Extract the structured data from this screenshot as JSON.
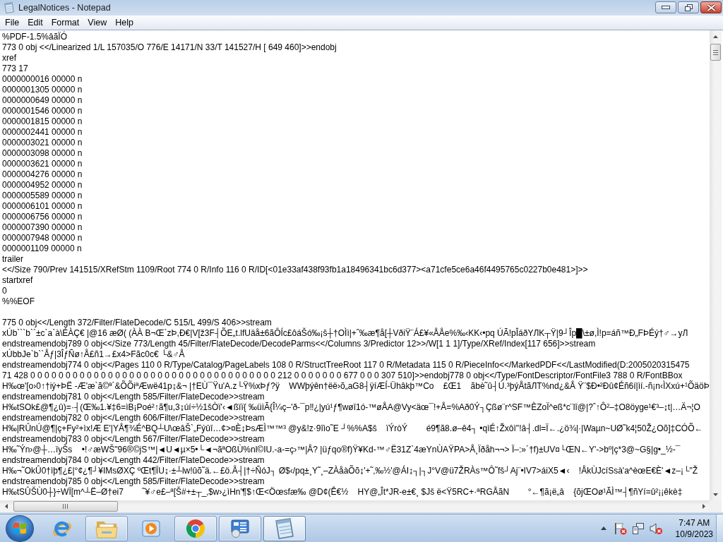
{
  "window": {
    "title": "LegalNotices - Notepad"
  },
  "menu_bar": [
    "File",
    "Edit",
    "Format",
    "View",
    "Help"
  ],
  "editor": {
    "sections": [
      {
        "lines": [
          "%PDF-1.5%âãÏÓ",
          "773 0 obj <</Linearized 1/L 157035/O 776/E 14171/N 33/T 141527/H [ 649 460]>>endobj",
          "xref",
          "773 17",
          "0000000016 00000 n",
          "0000001305 00000 n",
          "0000000649 00000 n",
          "0000001546 00000 n",
          "0000001815 00000 n",
          "0000002441 00000 n",
          "0000003021 00000 n",
          "0000003098 00000 n",
          "0000003621 00000 n",
          "0000004276 00000 n",
          "0000004952 00000 n",
          "0000005589 00000 n",
          "0000006101 00000 n",
          "0000006756 00000 n",
          "0000007390 00000 n",
          "0000007948 00000 n",
          "0000001109 00000 n",
          "trailer",
          "<</Size 790/Prev 141515/XRefStm 1109/Root 774 0 R/Info 116 0 R/ID[<01e33af438f93fb1a18496341bc6d377><a71cfe5ce6a46f4495765c0227b0e481>]>>",
          "startxref",
          "0",
          "%%EOF"
        ]
      },
      {
        "lines": [
          "775 0 obj<</Length 372/Filter/FlateDecode/C 515/L 499/S 406>>stream",
          "xÚb```b``±c`a`à\\ÉÀÇ€ |@16 æØ( (ÀÀ B¬Œ`zÞ,Ð€|V[ž3F┤ÕE„t.lfUäå±6ãÔÍc£ôáŠó‰¡š┼†OÌì|+ˆ‰æ¶å[┼VðiŸ¨Á£¥«ÅÅe%‰‹KK‹•pq ÚÃ!pÎáðYЛK┬Ÿ|9┘Îp█\\±ø,Ì!p=áñ™Ð„FÞÉý†♂→yЛ",
          "endstreamendobj789 0 obj<</Size 773/Length 45/Filter/FlateDecode/DecodeParms<</Columns 3/Predictor 12>>/W[1 1 1]/Type/XRef/Index[117 656]>>stream",
          "xÚbbJe`b``Åƒ|3ÎƒÑø↑Å£ñ1→£x4>Fãc0c€ └&♂Å",
          "endstreamendobj774 0 obj<</Pages 110 0 R/Type/Catalog/PageLabels 108 0 R/StructTreeRoot 117 0 R/Metadata 115 0 R/PieceInfo<</MarkedPDF<</LastModified(D:2005020315475",
          "71 428 0 0 0 0 0 0 0 0 0 0 0 0 0 0 0 0 0 0 0 0 0 0 0 0 0 0 0 0 0 0 0 0 0 0 0 212 0 0 0 0 0 0 0 677 0 0 0 307 510]>>endobj778 0 obj<</Type/FontDescriptor/FontFile3 788 0 R/FontBBox",
          "H‰œ'[o›0↑†iý+ÞË -Æ'æ`ã©ª´&ÕÕiªÆwë41p↨&¬ |†EÙ¯Ÿu'A.z└Ÿ%xÞƒ?ÿ    WWþýên†ëë›õ„aG8┤ÿíÆÍ-Ühâkþ™Co    £Œ1    ãbè˜û┤Ú.³þýÅtãЛT%nd¿&Å Ÿ¨$Ð•²Ðû¢Éñ6í|ìí.-ñ¡n‹ÌXxú+¹ÕäöÞ",
          "endstreamendobj781 0 obj<</Length 585/Filter/FlateDecode>>stream",
          "H‰tSOk£@¶¿û)=·┤(Œ‰1.¥‡6=ìB¡Poé²↑ã¶u,3↨úí÷½1šÒï'‹◄ßïï{ ‰üìÃ{Î¼ç–'ð-¯p‼¿|yú¹ƒ¶wøî1ó-™øÅA@Vy<äœ¯!+Å=%Að0Ý┐Çßø¨r^SF™ÈZoÏ^eß*c¨lî@|?ˆ↑Ô²–‡O8öyge¹€³–↨t|…Ä¬¦O",
          "endstreamendobj782 0 obj<</Length 606/Filter/FlateDecode>>stream",
          "H‰|RÛnÚ@¶|ç+Fy²+ìx!Æ E'|YÅ¶¾É^BQ┴U\\œâŠ`„Fýûî…¢>¤È↨ÞsÆÌ™™³ @y&!z·9îìo˜E ┘%%A$š    ïÝròÝ        é9¶ã8.ø–ê4┐ •qìÉ↑Žxôì\"!â┤.dl=Ï←.¿ö¾|·|Waµn~UØ˜k4¦50Ž¿Oõ]‡CÓÕ←",
          "endstreamendobj783 0 obj<</Length 567/Filter/FlateDecode>>stream",
          "H‰˜Ýn›@┼…ïyŠs    •!♂æWŠ\"96®©jS™|◄U◄µ×5•└◄¬ãªOßÙ%nl©IU.-a-=ç›™|Å? |üƒqo®f)Ÿ¥Kd-™♂Ë31Z`4æYnÙAŸPA>Å¸Ïðåh¬¬> Ï–:»´†f)±UV¤└ŒN←Y'->bº|ç*3@~G§|g•_½-¯",
          "endstreamendobj784 0 obj<</Length 442/Filter/FlateDecode>>stream",
          "H‰¬˜OkÛ0†ìþ¶¿£|°¢¿¶┘¥IMsØXÇ ºŒt¶ÏU↨·±┴lw!ûõ˜ä.←£ö.Å┤|†÷ÑóJ┐ Ø$‹/pq±¸Y˜¸–ZÀåàÕõ↨'+˜‚‰½'@ÁI↨┐|┐J°V@ü7ŽRÀs™Ô˜fš┘Aj¨•IV7>áiX5◄‹    !ÅkÙJcíSsà'a^èœE€È'◄z–¡└\"Ž",
          "endstreamendobj785 0 obj<</Length 585/Filter/FlateDecode>>stream",
          "H‰tSÛŠÙ0┼}÷WÏ[m^┴Ë–Ø†ei7        ˜¥♂e£–ª[Š#+±┬_‚$w›¿ìHn'¶$↑Œ<Öœsfæ‰ @D¢(Ê€½    HY@„Ît*JR-e±€¸ $Jš ë<Ÿ5RC+·ªRGÅãN        °←¶ã¡ë„â    {õjŒOø¹ÃÌ™┤¶ñYí=û²¡¡êkè‡"
        ]
      }
    ]
  },
  "taskbar": {
    "apps": [
      {
        "kind": "ie",
        "running": false,
        "selected": false
      },
      {
        "kind": "explorer",
        "running": true,
        "selected": false
      },
      {
        "kind": "player",
        "running": false,
        "selected": false
      },
      {
        "kind": "chrome",
        "running": true,
        "selected": false
      },
      {
        "kind": "panel",
        "running": true,
        "selected": false
      },
      {
        "kind": "notepad",
        "running": true,
        "selected": true
      }
    ],
    "tray": {
      "alert": true,
      "muted": true,
      "time": "7:47 AM",
      "date": "10/9/2023"
    }
  }
}
